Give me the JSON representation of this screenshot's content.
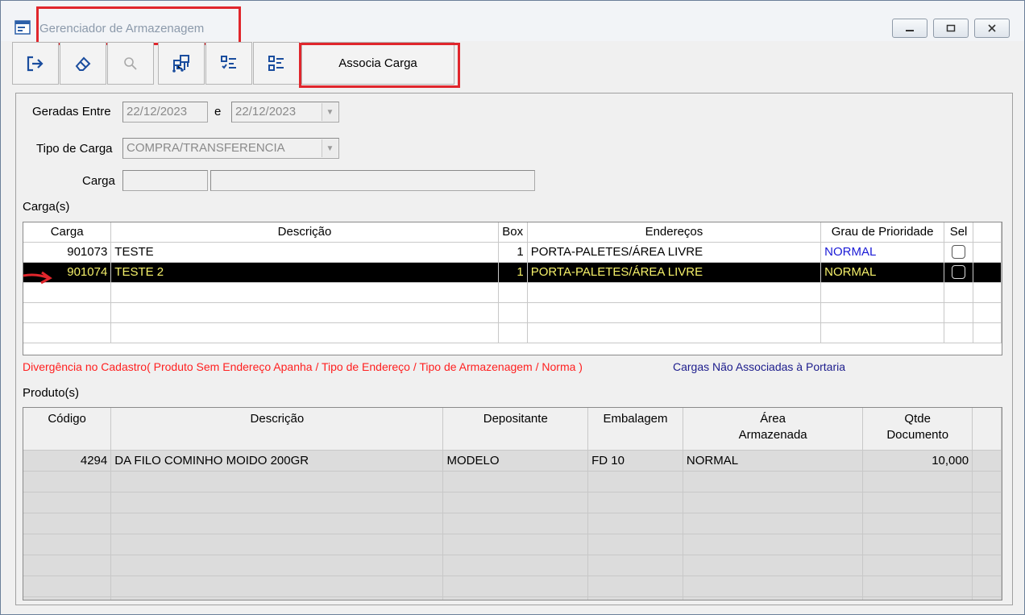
{
  "window": {
    "title": "Gerenciador de Armazenagem",
    "controls": [
      "minimize",
      "maximize",
      "close"
    ]
  },
  "toolbar": {
    "icons": [
      "exit-icon",
      "eraser-icon",
      "search-icon",
      "network-icon",
      "checklist-icon",
      "list-icon"
    ],
    "associa_label": "Associa Carga"
  },
  "filters": {
    "geradas_label": "Geradas Entre",
    "date_from": "22/12/2023",
    "e_label": "e",
    "date_to": "22/12/2023",
    "tipo_label": "Tipo de Carga",
    "tipo_value": "COMPRA/TRANSFERENCIA",
    "carga_label": "Carga",
    "carga_code": "",
    "carga_desc": ""
  },
  "cargas": {
    "section_label": "Carga(s)",
    "columns": [
      "Carga",
      "Descrição",
      "Box",
      "Endereços",
      "Grau de Prioridade",
      "Sel"
    ],
    "rows": [
      {
        "carga": "901073",
        "descricao": "TESTE",
        "box": "1",
        "enderecos": "PORTA-PALETES/ÁREA LIVRE",
        "prioridade": "NORMAL"
      },
      {
        "carga": "901074",
        "descricao": "TESTE 2",
        "box": "1",
        "enderecos": "PORTA-PALETES/ÁREA LIVRE",
        "prioridade": "NORMAL"
      }
    ],
    "selected_row": 1
  },
  "legend": {
    "divergencia": "Divergência no Cadastro( Produto Sem Endereço Apanha / Tipo de Endereço / Tipo de Armazenagem / Norma )",
    "nao_associadas": "Cargas Não Associadas à Portaria"
  },
  "produtos": {
    "section_label": "Produto(s)",
    "columns": [
      "Código",
      "Descrição",
      "Depositante",
      "Embalagem",
      "Área\nArmazenada",
      "Qtde\nDocumento"
    ],
    "col_area_1": "Área",
    "col_area_2": "Armazenada",
    "col_qtde_1": "Qtde",
    "col_qtde_2": "Documento",
    "rows": [
      {
        "codigo": "4294",
        "descricao": "DA FILO COMINHO MOIDO 200GR",
        "depositante": "MODELO",
        "embalagem": "FD 10",
        "area": "NORMAL",
        "qtde": "10,000"
      }
    ]
  },
  "colors": {
    "highlight_red": "#e0262c",
    "selected_text": "#f5f06a",
    "priority_blue": "#1a1ad6",
    "legend_red": "#ff2020",
    "legend_blue": "#1c1c8c"
  }
}
